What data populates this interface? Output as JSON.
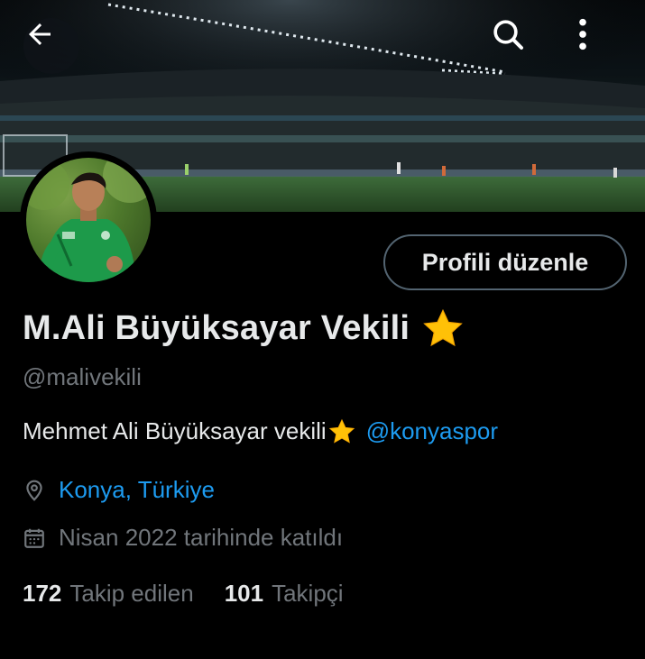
{
  "header": {
    "back_icon": "arrow-left-icon",
    "search_icon": "search-icon",
    "more_icon": "more-vertical-icon"
  },
  "banner": {
    "description_icon": "stadium-banner"
  },
  "profile": {
    "edit_button_label": "Profili düzenle",
    "display_name": "M.Ali Büyüksayar Vekili",
    "handle": "@malivekili",
    "bio_text": "Mehmet Ali Büyüksayar vekili",
    "bio_mention": "@konyaspor",
    "location": "Konya, Türkiye",
    "joined": "Nisan 2022 tarihinde katıldı",
    "following_count": "172",
    "following_label": "Takip edilen",
    "followers_count": "101",
    "followers_label": "Takipçi"
  },
  "colors": {
    "background": "#000000",
    "text_primary": "#e7e9ea",
    "text_secondary": "#71767b",
    "link": "#1d9bf0",
    "border": "#536471",
    "star": "#ffc107"
  }
}
